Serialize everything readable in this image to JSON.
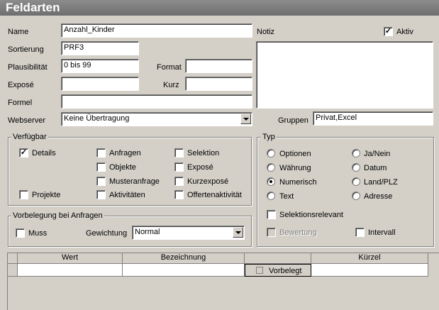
{
  "title": "Feldarten",
  "fields": {
    "name_label": "Name",
    "name_value": "Anzahl_Kinder",
    "sortierung_label": "Sortierung",
    "sortierung_value": "PRF3",
    "plausibilitaet_label": "Plausibilität",
    "plausibilitaet_value": "0 bis 99",
    "format_label": "Format",
    "format_value": "",
    "expose_label": "Exposé",
    "expose_value": "",
    "kurz_label": "Kurz",
    "kurz_value": "",
    "formel_label": "Formel",
    "formel_value": "",
    "webserver_label": "Webserver",
    "webserver_value": "Keine Übertragung",
    "notiz_label": "Notiz",
    "notiz_value": "",
    "aktiv_label": "Aktiv",
    "aktiv_checked": true,
    "gruppen_label": "Gruppen",
    "gruppen_value": "Privat,Excel"
  },
  "verfuegbar": {
    "title": "Verfügbar",
    "items": [
      {
        "label": "Details",
        "checked": true
      },
      {
        "label": "Projekte",
        "checked": false
      },
      {
        "label": "Anfragen",
        "checked": false
      },
      {
        "label": "Objekte",
        "checked": false
      },
      {
        "label": "Musteranfrage",
        "checked": false
      },
      {
        "label": "Aktivitäten",
        "checked": false
      },
      {
        "label": "Selektion",
        "checked": false
      },
      {
        "label": "Exposé",
        "checked": false
      },
      {
        "label": "Kurzexposé",
        "checked": false
      },
      {
        "label": "Offertenaktivität",
        "checked": false
      }
    ]
  },
  "vorbelegung": {
    "title": "Vorbelegung bei Anfragen",
    "muss_label": "Muss",
    "muss_checked": false,
    "gewichtung_label": "Gewichtung",
    "gewichtung_value": "Normal"
  },
  "typ": {
    "title": "Typ",
    "options": [
      "Optionen",
      "Währung",
      "Numerisch",
      "Text",
      "Ja/Nein",
      "Datum",
      "Land/PLZ",
      "Adresse"
    ],
    "selected": "Numerisch",
    "selektionsrelevant_label": "Selektionsrelevant",
    "bewertung_label": "Bewertung",
    "intervall_label": "Intervall"
  },
  "grid": {
    "columns": [
      "Wert",
      "Bezeichnung",
      "",
      "Kürzel"
    ],
    "row": {
      "vorbelegt_label": "Vorbelegt"
    }
  }
}
